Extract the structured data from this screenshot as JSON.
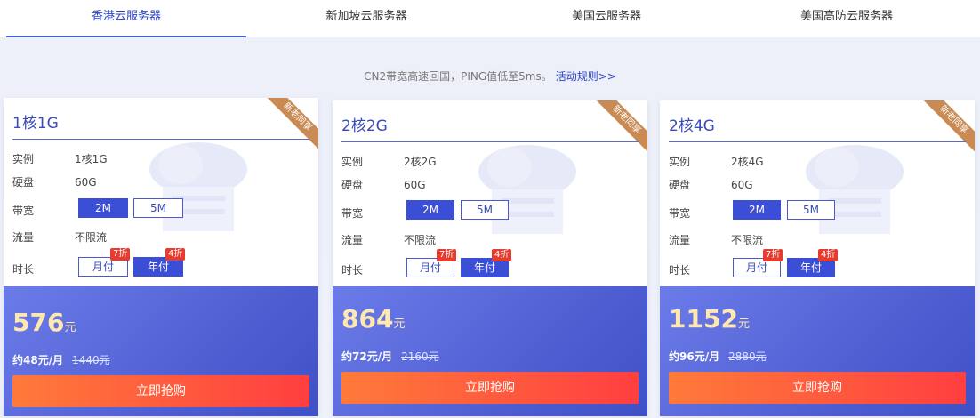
{
  "tabs": [
    "香港云服务器",
    "新加坡云服务器",
    "美国云服务器",
    "美国高防云服务器"
  ],
  "notice": {
    "text": "CN2带宽高速回国，PING值低至5ms。",
    "link": "活动规则>>"
  },
  "ribbon": "新老同享",
  "labels": {
    "instance": "实例",
    "disk": "硬盘",
    "bandwidth": "带宽",
    "traffic": "流量",
    "duration": "时长"
  },
  "options": {
    "bw1": "2M",
    "bw2": "5M",
    "monthly": "月付",
    "yearly": "年付",
    "disc_month": "7折",
    "disc_year": "4折"
  },
  "buy_label": "立即抢购",
  "yuan": "元",
  "cards": [
    {
      "title": "1核1G",
      "instance": "1核1G",
      "disk": "60G",
      "traffic": "不限流",
      "price": "576",
      "per_month": "约48元/月",
      "original": "1440元"
    },
    {
      "title": "2核2G",
      "instance": "2核2G",
      "disk": "60G",
      "traffic": "不限流",
      "price": "864",
      "per_month": "约72元/月",
      "original": "2160元"
    },
    {
      "title": "2核4G",
      "instance": "2核4G",
      "disk": "60G",
      "traffic": "不限流",
      "price": "1152",
      "per_month": "约96元/月",
      "original": "2880元"
    }
  ]
}
